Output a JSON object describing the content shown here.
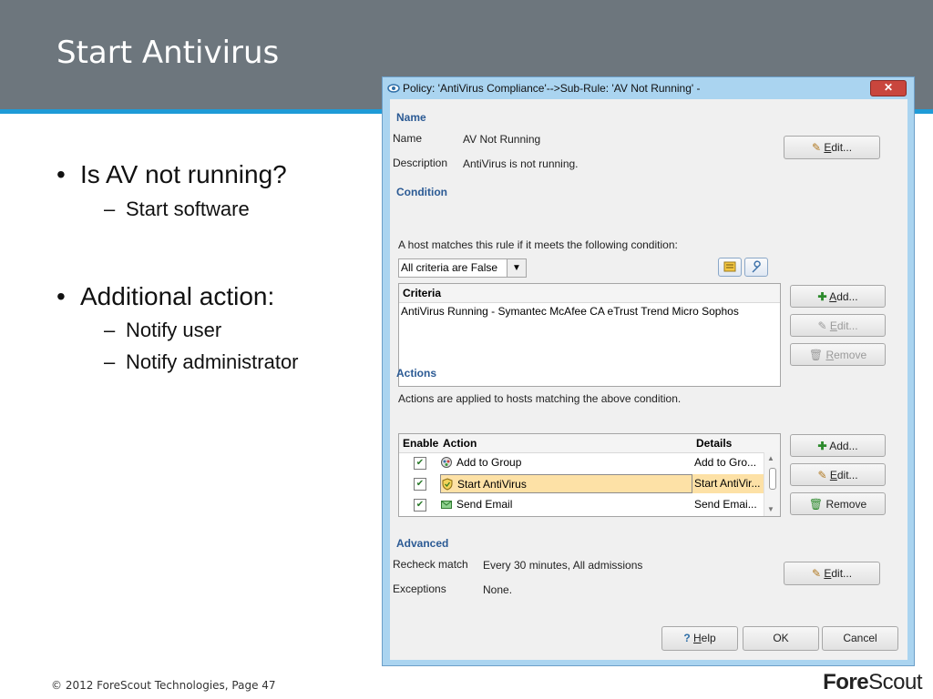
{
  "slide": {
    "title": "Start Antivirus",
    "bullets": [
      {
        "text": "Is AV not running?",
        "sub": [
          "Start software"
        ]
      },
      {
        "text": "Additional action:",
        "sub": [
          "Notify user",
          "Notify administrator"
        ]
      }
    ],
    "bullet_char": "•",
    "sub_char": "–",
    "footer": "© 2012 ForeScout Technologies, Page 47",
    "logo": {
      "part1": "Fore",
      "part2": "Scout"
    },
    "colors": {
      "header": "#6d767d",
      "accent_line": "#1f9bd7"
    }
  },
  "dialog": {
    "title": "Policy: 'AntiVirus Compliance'-->Sub-Rule: 'AV Not Running' -",
    "close": "✕",
    "name_section": {
      "heading": "Name",
      "name_label": "Name",
      "name_value": "AV Not Running",
      "description_label": "Description",
      "description_value": "AntiVirus is not running.",
      "edit_mnemonic": "E",
      "edit_rest": "dit..."
    },
    "condition": {
      "heading": "Condition",
      "intro": "A host matches this rule if it meets the following condition:",
      "combo_value": "All criteria are False",
      "criteria_header": "Criteria",
      "criteria_rows": [
        "AntiVirus Running - Symantec McAfee CA eTrust Trend Micro Sophos"
      ],
      "buttons": {
        "add": {
          "m": "A",
          "rest": "dd..."
        },
        "edit": {
          "m": "E",
          "rest": "dit..."
        },
        "remove": {
          "m": "R",
          "rest": "emove"
        }
      }
    },
    "actions": {
      "heading": "Actions",
      "intro": "Actions are applied to hosts matching the above condition.",
      "columns": {
        "enable": "Enable",
        "action": "Action",
        "details": "Details"
      },
      "rows": [
        {
          "enabled": true,
          "action": "Add to Group",
          "details": "Add to Gro...",
          "icon": "add-group-icon"
        },
        {
          "enabled": true,
          "action": "Start AntiVirus",
          "details": "Start AntiVir...",
          "icon": "shield-icon",
          "selected": true
        },
        {
          "enabled": true,
          "action": "Send Email",
          "details": "Send Emai...",
          "icon": "email-icon"
        }
      ],
      "buttons": {
        "add": {
          "m": "",
          "rest": "Add..."
        },
        "edit": {
          "m": "E",
          "rest": "dit..."
        },
        "remove": {
          "m": "",
          "rest": "Remove"
        }
      }
    },
    "advanced": {
      "heading": "Advanced",
      "recheck_label": "Recheck match",
      "recheck_value": "Every 30 minutes, All admissions",
      "exceptions_label": "Exceptions",
      "exceptions_value": "None.",
      "edit_mnemonic": "E",
      "edit_rest": "dit..."
    },
    "footer_buttons": {
      "help_m": "H",
      "help_rest": "elp",
      "ok": "OK",
      "cancel": "Cancel"
    }
  }
}
